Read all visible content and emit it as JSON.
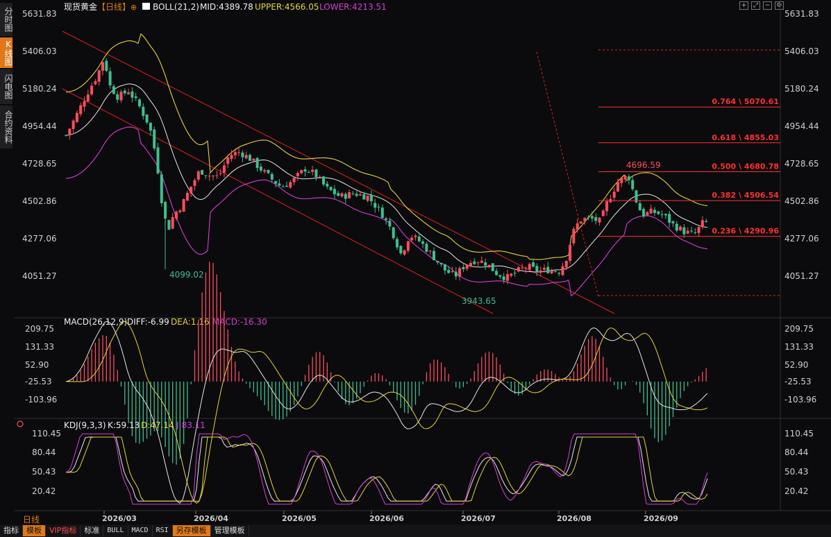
{
  "sidebar": {
    "items": [
      {
        "label": "分时图",
        "active": false
      },
      {
        "label": "K线图",
        "active": true
      },
      {
        "label": "闪电图",
        "active": false
      },
      {
        "label": "合约资料",
        "active": false
      }
    ]
  },
  "header": {
    "symbol": "现货黄金",
    "period": "【日线】",
    "boll_label": "BOLL(21,2)",
    "mid": "MID:4389.78",
    "upper": "UPPER:4566.05",
    "lower": "LOWER:4213.51"
  },
  "price_axis": [
    "5631.83",
    "5406.03",
    "5180.24",
    "4954.44",
    "4728.65",
    "4502.86",
    "4277.06",
    "4051.27"
  ],
  "annotations": {
    "low1": "4099.02",
    "low2": "3943.65",
    "high1": "4696.59"
  },
  "fib_levels": [
    {
      "label": "0.764 \\ 5070.61",
      "value": 5070.61
    },
    {
      "label": "0.618 \\ 4855.03",
      "value": 4855.03
    },
    {
      "label": "0.500 \\ 4680.78",
      "value": 4680.78
    },
    {
      "label": "0.382 \\ 4506.54",
      "value": 4506.54
    },
    {
      "label": "0.236 \\ 4290.96",
      "value": 4290.96
    }
  ],
  "macd": {
    "header": "MACD(26,12,9)",
    "diff": "DIFF:-6.99",
    "dea": "DEA:1.16",
    "macd": "MACD:-16.30",
    "axis": [
      "209.75",
      "131.33",
      "52.90",
      "-25.53",
      "-103.96"
    ]
  },
  "kdj": {
    "header": "KDJ(9,3,3)",
    "k": "K:59.13",
    "d": "D:47.14",
    "j": "J:83.11",
    "axis": [
      "110.45",
      "80.44",
      "50.43",
      "20.42"
    ]
  },
  "dates": [
    "2026/03",
    "2026/04",
    "2026/05",
    "2026/06",
    "2026/07",
    "2026/08",
    "2026/09"
  ],
  "period_label": "日线",
  "toolbar": [
    {
      "label": "指标",
      "style": "normal"
    },
    {
      "label": "模板",
      "style": "orange"
    },
    {
      "label": "VIP指标",
      "style": "red"
    },
    {
      "label": "标准",
      "style": "normal"
    },
    {
      "label": "BULL",
      "style": "mono"
    },
    {
      "label": "MACD",
      "style": "mono"
    },
    {
      "label": "RSI",
      "style": "mono"
    },
    {
      "label": "另存模板",
      "style": "orange"
    },
    {
      "label": "管理模板",
      "style": "normal"
    }
  ],
  "colors": {
    "up": "#ff4d5e",
    "down": "#3fbf8f",
    "mid": "#e8e8e8",
    "upper": "#e6d53c",
    "lower": "#d43fd4",
    "fib": "#ff3030",
    "channel": "#e02020",
    "accent": "#e0791a"
  }
}
